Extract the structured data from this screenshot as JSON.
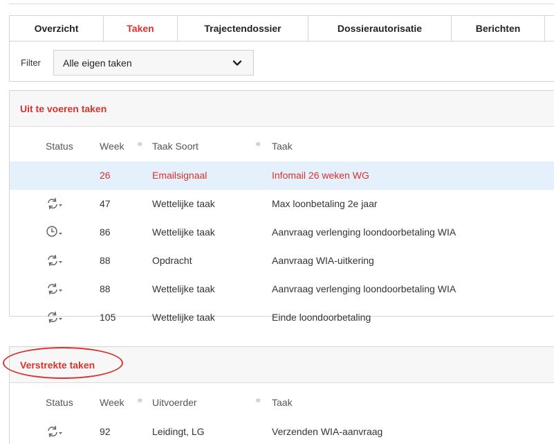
{
  "tabs": [
    {
      "label": "Overzicht",
      "active": false
    },
    {
      "label": "Taken",
      "active": true
    },
    {
      "label": "Trajectendossier",
      "active": false
    },
    {
      "label": "Dossierautorisatie",
      "active": false
    },
    {
      "label": "Berichten",
      "active": false
    }
  ],
  "filter": {
    "label": "Filter",
    "selected": "Alle eigen taken"
  },
  "sort_glyph": "≑",
  "uit_te_voeren": {
    "title": "Uit te voeren taken",
    "columns": {
      "status": "Status",
      "week": "Week",
      "soort": "Taak Soort",
      "taak": "Taak"
    },
    "rows": [
      {
        "status_icon": "none",
        "week": "26",
        "soort": "Emailsignaal",
        "taak": "Infomail 26 weken WG",
        "highlight": true
      },
      {
        "status_icon": "refresh-icon",
        "week": "47",
        "soort": "Wettelijke taak",
        "taak": "Max loonbetaling 2e jaar",
        "highlight": false
      },
      {
        "status_icon": "clock-icon",
        "week": "86",
        "soort": "Wettelijke taak",
        "taak": "Aanvraag verlenging loondoorbetaling WIA",
        "highlight": false
      },
      {
        "status_icon": "refresh-icon",
        "week": "88",
        "soort": "Opdracht",
        "taak": "Aanvraag WIA-uitkering",
        "highlight": false
      },
      {
        "status_icon": "refresh-icon",
        "week": "88",
        "soort": "Wettelijke taak",
        "taak": "Aanvraag verlenging loondoorbetaling WIA",
        "highlight": false
      },
      {
        "status_icon": "refresh-icon",
        "week": "105",
        "soort": "Wettelijke taak",
        "taak": "Einde loondoorbetaling",
        "highlight": false
      }
    ]
  },
  "verstrekte": {
    "title": "Verstrekte taken",
    "columns": {
      "status": "Status",
      "week": "Week",
      "uitvoerder": "Uitvoerder",
      "taak": "Taak"
    },
    "rows": [
      {
        "status_icon": "refresh-icon",
        "week": "92",
        "uitvoerder": "Leidingt, LG",
        "taak": "Verzenden WIA-aanvraag"
      }
    ]
  },
  "colors": {
    "accent": "#d9312b",
    "highlight_row": "#e4f0fb",
    "panel_head": "#f7f7f7"
  }
}
